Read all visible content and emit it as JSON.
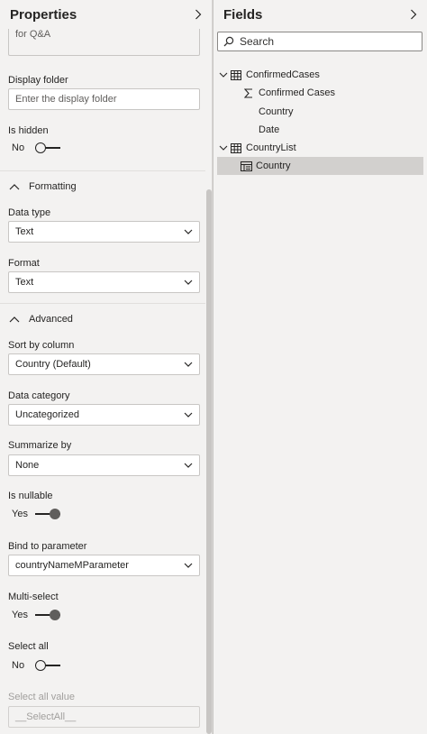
{
  "properties": {
    "title": "Properties",
    "truncated_text": "for Q&A",
    "display_folder": {
      "label": "Display folder",
      "placeholder": "Enter the display folder"
    },
    "is_hidden": {
      "label": "Is hidden",
      "value": "No"
    },
    "formatting": {
      "header": "Formatting",
      "data_type": {
        "label": "Data type",
        "value": "Text"
      },
      "format": {
        "label": "Format",
        "value": "Text"
      }
    },
    "advanced": {
      "header": "Advanced",
      "sort_by_column": {
        "label": "Sort by column",
        "value": "Country (Default)"
      },
      "data_category": {
        "label": "Data category",
        "value": "Uncategorized"
      },
      "summarize_by": {
        "label": "Summarize by",
        "value": "None"
      },
      "is_nullable": {
        "label": "Is nullable",
        "value": "Yes"
      },
      "bind_to_parameter": {
        "label": "Bind to parameter",
        "value": "countryNameMParameter"
      },
      "multi_select": {
        "label": "Multi-select",
        "value": "Yes"
      },
      "select_all": {
        "label": "Select all",
        "value": "No"
      },
      "select_all_value": {
        "label": "Select all value",
        "value": "__SelectAll__"
      }
    }
  },
  "fields": {
    "title": "Fields",
    "search_placeholder": "Search",
    "tables": [
      {
        "name": "ConfirmedCases",
        "items": [
          "Confirmed Cases",
          "Country",
          "Date"
        ]
      },
      {
        "name": "CountryList",
        "items": [
          "Country"
        ]
      }
    ]
  },
  "icons": {
    "collapse": "chevron-right-icon",
    "section": "chevron-up-icon",
    "dropdown": "chevron-down-icon",
    "search": "search-icon",
    "table": "table-icon",
    "sum": "sigma-icon",
    "hierarchy": "hierarchy-icon"
  }
}
